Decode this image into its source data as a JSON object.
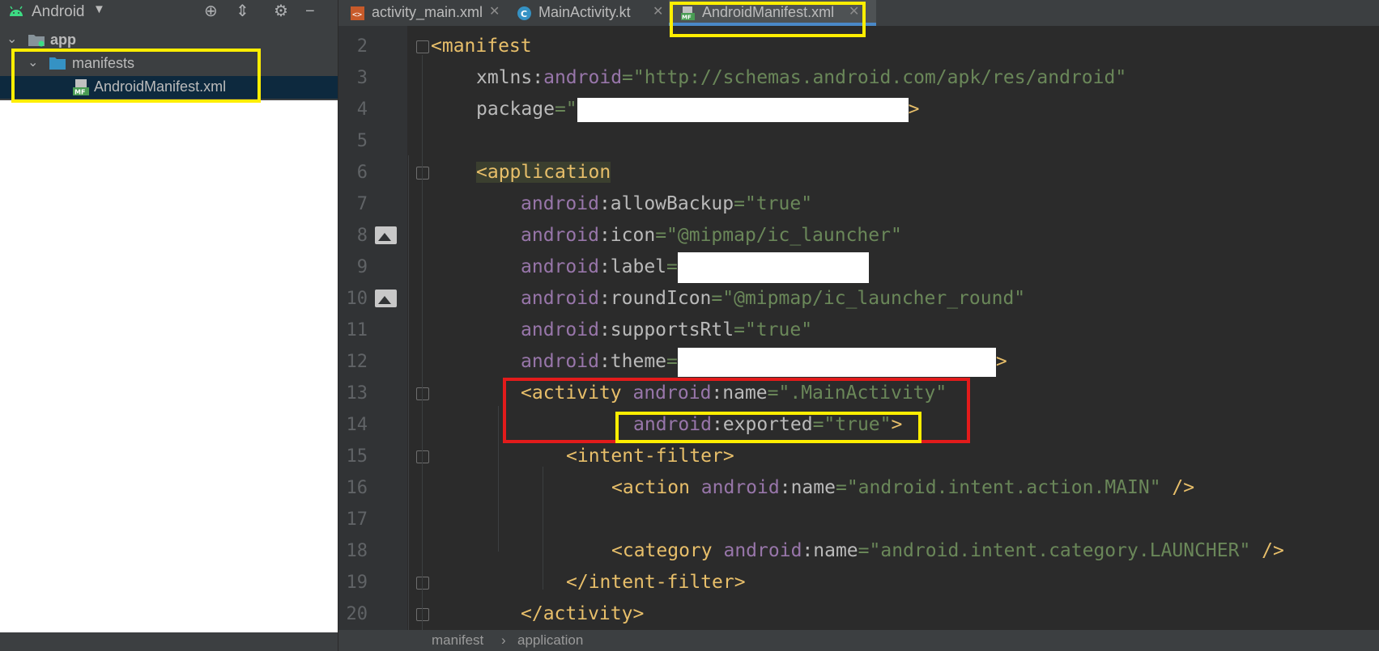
{
  "project": {
    "view": "Android",
    "tree": {
      "app": "app",
      "manifests": "manifests",
      "manifest_file": "AndroidManifest.xml"
    }
  },
  "tabs": [
    {
      "label": "activity_main.xml",
      "icon": "xml-layout-icon"
    },
    {
      "label": "MainActivity.kt",
      "icon": "kotlin-class-icon"
    },
    {
      "label": "AndroidManifest.xml",
      "icon": "manifest-file-icon",
      "active": true
    }
  ],
  "editor": {
    "line_numbers": [
      "2",
      "3",
      "4",
      "5",
      "6",
      "7",
      "8",
      "9",
      "10",
      "11",
      "12",
      "13",
      "14",
      "15",
      "16",
      "17",
      "18",
      "19",
      "20"
    ],
    "lines": {
      "l2_tag": "<manifest",
      "l3_ns": "xmlns",
      "l3_colon": ":",
      "l3_attr": "android",
      "l3_eq": "=",
      "l3_val": "\"http://schemas.android.com/apk/res/android\"",
      "l4_attr": "package",
      "l4_eq": "=\"",
      "l4_end": ">",
      "l6_tag_open": "<",
      "l6_tag": "application",
      "l7_ns": "android",
      "l7_attr": ":allowBackup",
      "l7_val": "=\"true\"",
      "l8_ns": "android",
      "l8_attr": ":icon",
      "l8_val": "=\"@mipmap/ic_launcher\"",
      "l9_ns": "android",
      "l9_attr": ":label",
      "l9_eq": "=",
      "l10_ns": "android",
      "l10_attr": ":roundIcon",
      "l10_val": "=\"@mipmap/ic_launcher_round\"",
      "l11_ns": "android",
      "l11_attr": ":supportsRtl",
      "l11_val": "=\"true\"",
      "l12_ns": "android",
      "l12_attr": ":theme",
      "l12_eq": "=",
      "l12_end": ">",
      "l13_tag": "<activity",
      "l13_ns": "android",
      "l13_attr": ":name",
      "l13_val": "=\".MainActivity\"",
      "l14_ns": "android",
      "l14_attr": ":exported",
      "l14_val": "=\"true\"",
      "l14_end": ">",
      "l15_tag": "<intent-filter>",
      "l16_tag": "<action",
      "l16_ns": "android",
      "l16_attr": ":name",
      "l16_val": "=\"android.intent.action.MAIN\"",
      "l16_end": " />",
      "l18_tag": "<category",
      "l18_ns": "android",
      "l18_attr": ":name",
      "l18_val": "=\"android.intent.category.LAUNCHER\"",
      "l18_end": " />",
      "l19_tag": "</intent-filter>",
      "l20_tag": "</activity>"
    }
  },
  "breadcrumb": [
    "manifest",
    "application"
  ],
  "colors": {
    "annotation_yellow": "#ffee00",
    "annotation_red": "#e31b1b",
    "xml_tag": "#e8bf6a",
    "xml_namespace": "#9876aa",
    "xml_value": "#6a8759"
  }
}
